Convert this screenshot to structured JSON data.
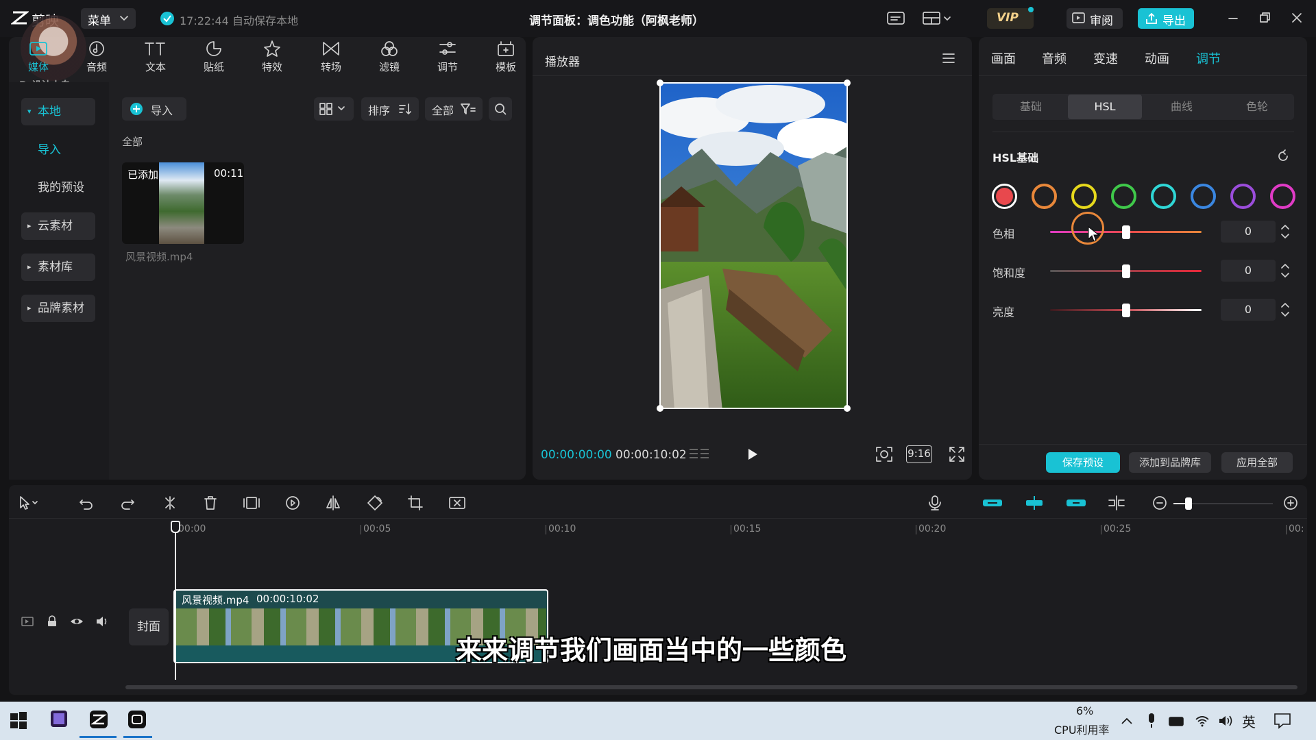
{
  "app": {
    "name": "剪映",
    "menu_label": "菜单",
    "autosave": "17:22:44 自动保存本地",
    "title": "调节面板：调色功能（阿枫老师）",
    "review_label": "审阅",
    "export_label": "导出",
    "vip_label": "VIP"
  },
  "watermark": "Ps设计小白",
  "toolbar": {
    "items": [
      {
        "label": "媒体",
        "icon": "media-icon"
      },
      {
        "label": "音频",
        "icon": "audio-icon"
      },
      {
        "label": "文本",
        "icon": "text-icon"
      },
      {
        "label": "贴纸",
        "icon": "sticker-icon"
      },
      {
        "label": "特效",
        "icon": "effects-icon"
      },
      {
        "label": "转场",
        "icon": "transition-icon"
      },
      {
        "label": "滤镜",
        "icon": "filter-icon"
      },
      {
        "label": "调节",
        "icon": "adjust-icon"
      },
      {
        "label": "模板",
        "icon": "template-icon"
      }
    ]
  },
  "sidebar": {
    "items": [
      {
        "label": "本地",
        "expanded": true
      },
      {
        "label": "导入"
      },
      {
        "label": "我的预设"
      },
      {
        "label": "云素材"
      },
      {
        "label": "素材库"
      },
      {
        "label": "品牌素材"
      }
    ]
  },
  "media": {
    "import_label": "导入",
    "sort_label": "排序",
    "filter_label": "全部",
    "section_label": "全部",
    "clip": {
      "badge": "已添加",
      "duration": "00:11",
      "filename": "风景视频.mp4"
    }
  },
  "player": {
    "title": "播放器",
    "current_time": "00:00:00:00",
    "total_time": "00:00:10:02",
    "ratio": "9:16"
  },
  "right_panel": {
    "tabs": [
      "画面",
      "音频",
      "变速",
      "动画",
      "调节"
    ],
    "active_tab": "调节",
    "subtabs": [
      "基础",
      "HSL",
      "曲线",
      "色轮"
    ],
    "active_subtab": "HSL",
    "section_title": "HSL基础",
    "swatches": [
      {
        "name": "red",
        "color": "#e8484d",
        "selected": true
      },
      {
        "name": "orange",
        "color": "#e8873a"
      },
      {
        "name": "yellow",
        "color": "#e6d81c"
      },
      {
        "name": "green",
        "color": "#3fc84a"
      },
      {
        "name": "cyan",
        "color": "#2fd6d6"
      },
      {
        "name": "blue",
        "color": "#3a86e0"
      },
      {
        "name": "purple",
        "color": "#9b4ddb"
      },
      {
        "name": "magenta",
        "color": "#e03bc6"
      }
    ],
    "sliders": [
      {
        "label": "色相",
        "value": "0",
        "level": 0.5
      },
      {
        "label": "饱和度",
        "value": "0",
        "level": 0.5
      },
      {
        "label": "亮度",
        "value": "0",
        "level": 0.5
      }
    ],
    "buttons": {
      "save_preset": "保存预设",
      "add_brand": "添加到品牌库",
      "apply_all": "应用全部"
    }
  },
  "timeline": {
    "ruler": [
      "00:00",
      "00:05",
      "00:10",
      "00:15",
      "00:20",
      "00:25",
      "00:"
    ],
    "cover_label": "封面",
    "clip_name": "风景视频.mp4",
    "clip_duration": "00:00:10:02"
  },
  "subtitle": "来来调节我们画面当中的一些颜色",
  "taskbar": {
    "cpu_percent": "6%",
    "cpu_label": "CPU利用率",
    "ime": "英"
  },
  "colors": {
    "accent": "#19c2d4",
    "bg": "#141416",
    "panel": "#1f1f22"
  }
}
